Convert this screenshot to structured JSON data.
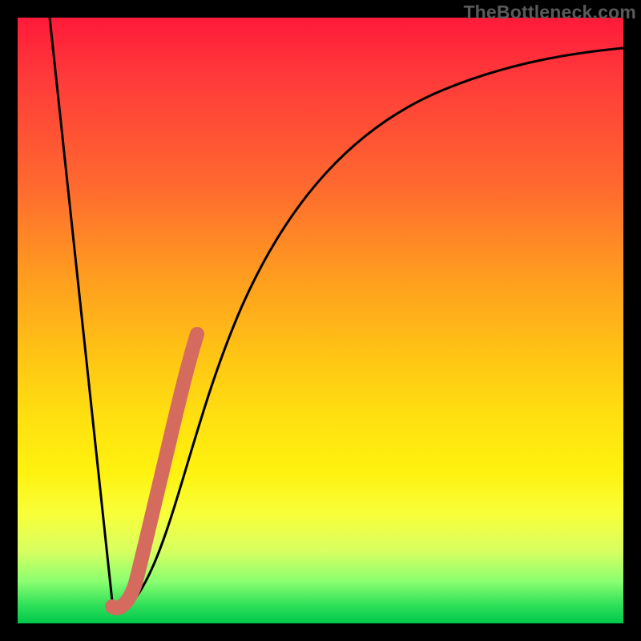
{
  "watermark": "TheBottleneck.com",
  "chart_data": {
    "type": "line",
    "title": "",
    "xlabel": "",
    "ylabel": "",
    "xlim": [
      0,
      100
    ],
    "ylim": [
      0,
      100
    ],
    "grid": false,
    "legend": null,
    "series": [
      {
        "name": "bottleneck-curve",
        "color": "#000000",
        "x": [
          4,
          6,
          8,
          10,
          12,
          14,
          16,
          17,
          18,
          20,
          22,
          25,
          28,
          32,
          36,
          40,
          45,
          50,
          56,
          62,
          70,
          78,
          86,
          94,
          100
        ],
        "y": [
          100,
          84,
          68,
          52,
          36,
          20,
          8,
          2,
          1,
          6,
          18,
          33,
          46,
          58,
          67,
          74,
          80,
          84,
          88,
          90.5,
          92.5,
          94,
          95,
          95.8,
          96.2
        ]
      },
      {
        "name": "highlight-segment",
        "color": "#d56a5e",
        "x": [
          16.5,
          17.5,
          19,
          21,
          23,
          25,
          27.5,
          30
        ],
        "y": [
          2,
          1,
          3,
          10,
          20,
          30,
          41,
          51
        ]
      }
    ],
    "background_gradient": {
      "top": "#ff1a3a",
      "upper_mid": "#ff9a20",
      "mid": "#ffe010",
      "lower_mid": "#d8ff60",
      "bottom": "#00c84a"
    }
  }
}
